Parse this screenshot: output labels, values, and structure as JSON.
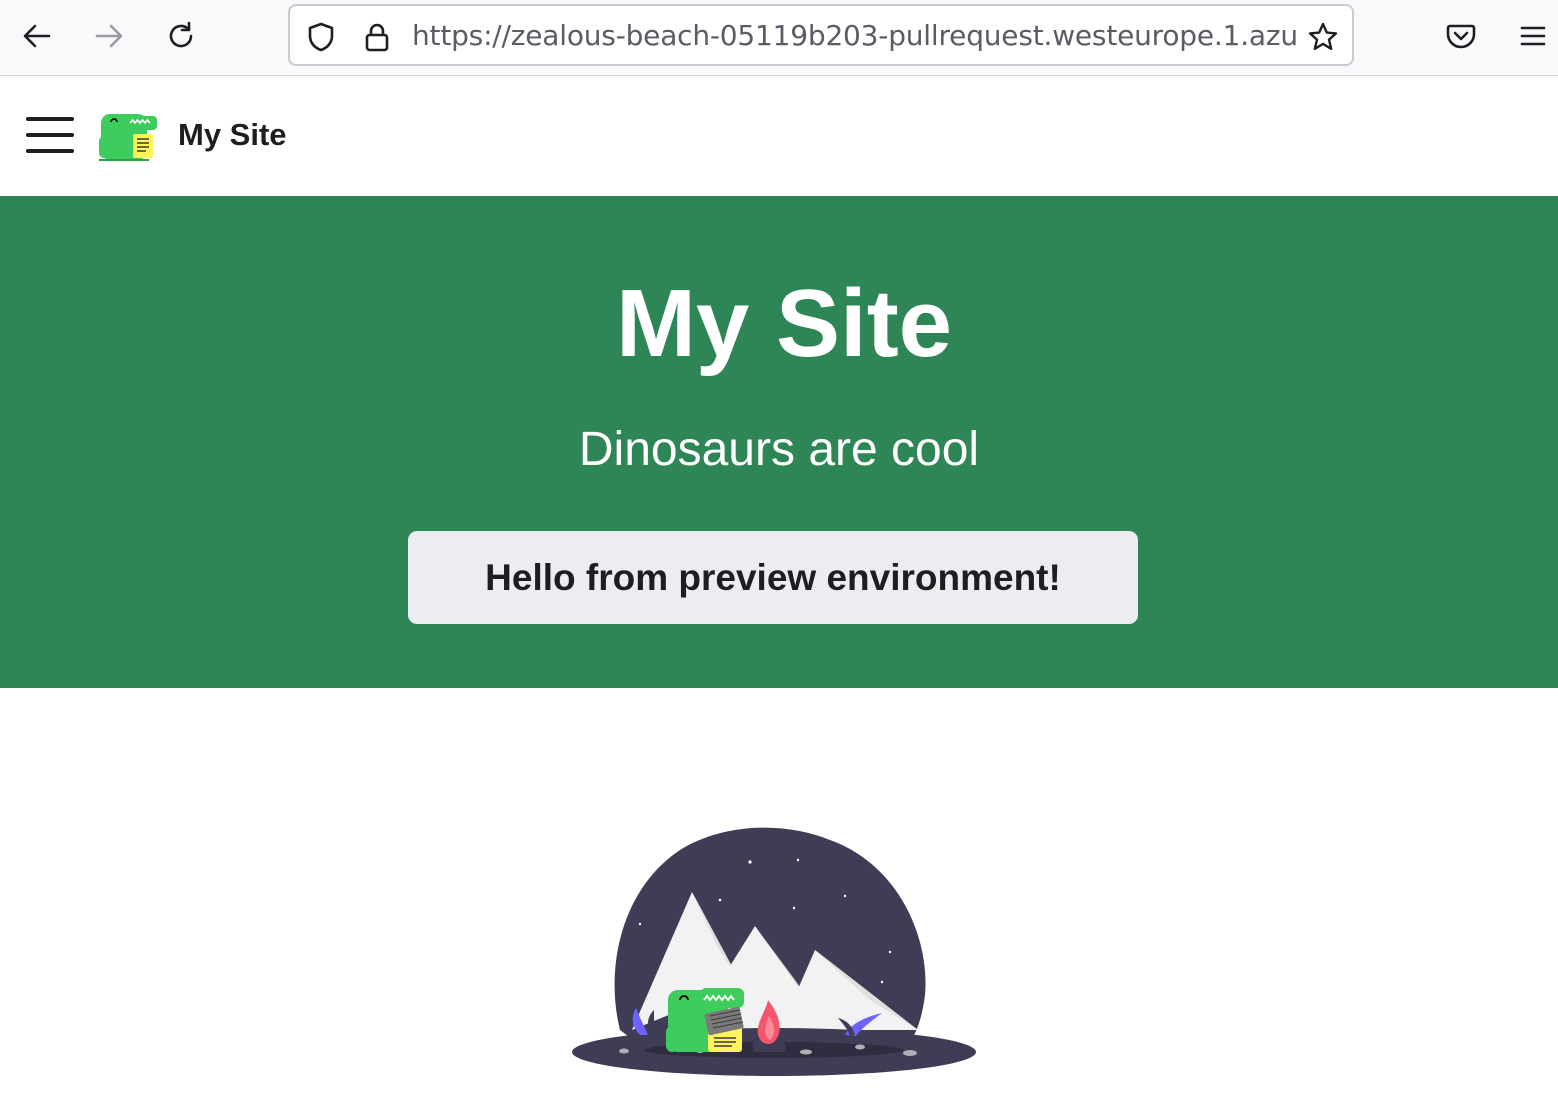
{
  "browser": {
    "url": "https://zealous-beach-05119b203-pullrequest.westeurope.1.azu"
  },
  "navbar": {
    "title": "My Site"
  },
  "hero": {
    "title": "My Site",
    "subtitle": "Dinosaurs are cool",
    "button_label": "Hello from preview environment!"
  },
  "colors": {
    "brand": "#2e8555",
    "button_bg": "#ebedf0",
    "text_dark": "#1c1e21"
  }
}
